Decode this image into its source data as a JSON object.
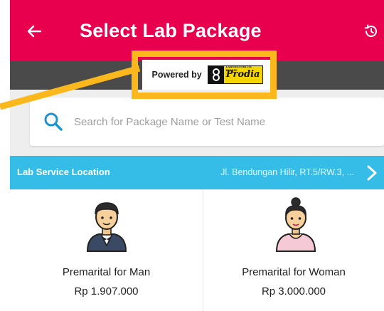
{
  "header": {
    "title": "Select Lab Package",
    "back_icon": "arrow-left-icon",
    "history_icon": "history-icon",
    "background": "#e8004f"
  },
  "powered_by": {
    "label": "Powered by",
    "logo_name": "Prodia",
    "logo_small_text": "LABORATORIUM KLINIK"
  },
  "search": {
    "placeholder": "Search for Package Name or Test Name",
    "value": ""
  },
  "location": {
    "label": "Lab Service Location",
    "value": "Jl. Bendungan Hilir, RT.5/RW.3, ...",
    "background": "#35bde8"
  },
  "packages": [
    {
      "name": "Premarital for Man",
      "price": "Rp 1.907.000",
      "icon": "man-avatar-icon"
    },
    {
      "name": "Premarital for Woman",
      "price": "Rp 3.000.000",
      "icon": "woman-avatar-icon"
    }
  ],
  "annotation": {
    "color": "#fbb81c"
  }
}
